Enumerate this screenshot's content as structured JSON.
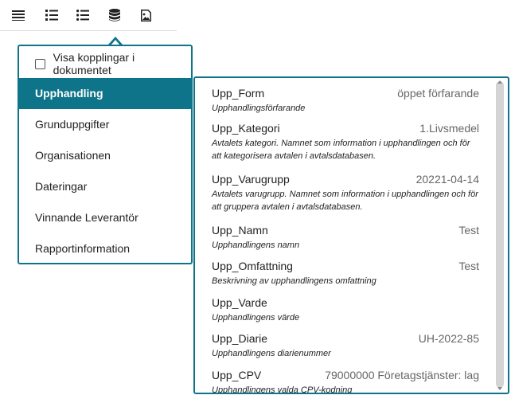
{
  "toolbar": {
    "buttons": [
      {
        "icon": "align-justify-icon"
      },
      {
        "icon": "numbered-list-icon"
      },
      {
        "icon": "bullet-list-icon"
      },
      {
        "icon": "database-icon"
      },
      {
        "icon": "image-icon"
      }
    ]
  },
  "menu": {
    "checkbox_label": "Visa kopplingar i dokumentet",
    "categories": [
      {
        "label": "Upphandling",
        "active": true
      },
      {
        "label": "Grunduppgifter"
      },
      {
        "label": "Organisationen"
      },
      {
        "label": "Dateringar"
      },
      {
        "label": "Vinnande Leverantör"
      },
      {
        "label": "Rapportinformation"
      }
    ]
  },
  "fields": [
    {
      "name": "Upp_Form",
      "value": "öppet förfarande",
      "desc": "Upphandlingsförfarande"
    },
    {
      "name": "Upp_Kategori",
      "value": "1.Livsmedel",
      "desc": "Avtalets kategori. Namnet som information i upphandlingen och för att kategorisera avtalen i avtalsdatabasen."
    },
    {
      "name": "Upp_Varugrupp",
      "value": "20221-04-14",
      "desc": "Avtalets varugrupp. Namnet som information i upphandlingen och för att gruppera avtalen i avtalsdatabasen."
    },
    {
      "name": "Upp_Namn",
      "value": "Test",
      "desc": "Upphandlingens namn"
    },
    {
      "name": "Upp_Omfattning",
      "value": "Test",
      "desc": "Beskrivning av upphandlingens omfattning"
    },
    {
      "name": "Upp_Varde",
      "value": "",
      "desc": "Upphandlingens värde"
    },
    {
      "name": "Upp_Diarie",
      "value": "UH-2022-85",
      "desc": "Upphandlingens diarienummer"
    },
    {
      "name": "Upp_CPV",
      "value": "79000000 Företagstjänster: lag",
      "desc": "Upphandlingens valda CPV-kodning"
    }
  ],
  "colors": {
    "accent": "#0e7489"
  }
}
